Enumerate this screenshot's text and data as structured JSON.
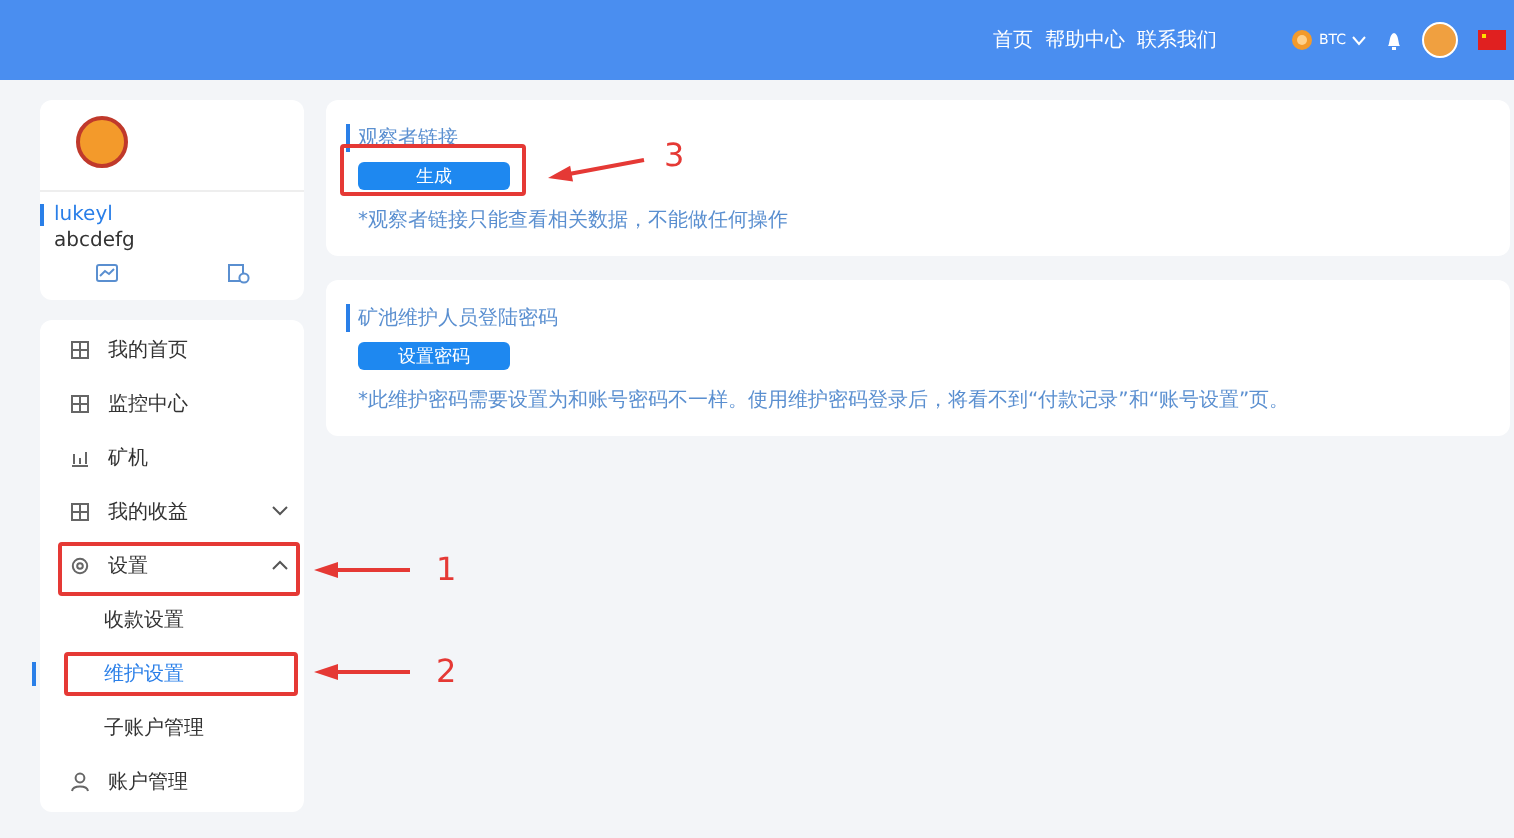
{
  "header": {
    "nav": [
      "首页",
      "帮助中心",
      "联系我们"
    ],
    "currency": "BTC"
  },
  "profile": {
    "username": "lukeyl",
    "subaccount": "abcdefg"
  },
  "menu": [
    {
      "label": "我的首页",
      "kind": "grid"
    },
    {
      "label": "监控中心",
      "kind": "grid"
    },
    {
      "label": "矿机",
      "kind": "chart"
    },
    {
      "label": "我的收益",
      "kind": "grid",
      "expanded": false
    },
    {
      "label": "设置",
      "kind": "gear",
      "expanded": true,
      "children": [
        {
          "label": "收款设置",
          "selected": false
        },
        {
          "label": "维护设置",
          "selected": true
        },
        {
          "label": "子账户管理",
          "selected": false
        }
      ]
    },
    {
      "label": "账户管理",
      "kind": "person"
    }
  ],
  "cards": [
    {
      "title": "观察者链接",
      "button": "生成",
      "note": "*观察者链接只能查看相关数据，不能做任何操作"
    },
    {
      "title": "矿池维护人员登陆密码",
      "button": "设置密码",
      "note": "*此维护密码需要设置为和账号密码不一样。使用维护密码登录后，将看不到“付款记录”和“账号设置”页。"
    }
  ],
  "annotations": [
    {
      "label": "1"
    },
    {
      "label": "2"
    },
    {
      "label": "3"
    }
  ]
}
